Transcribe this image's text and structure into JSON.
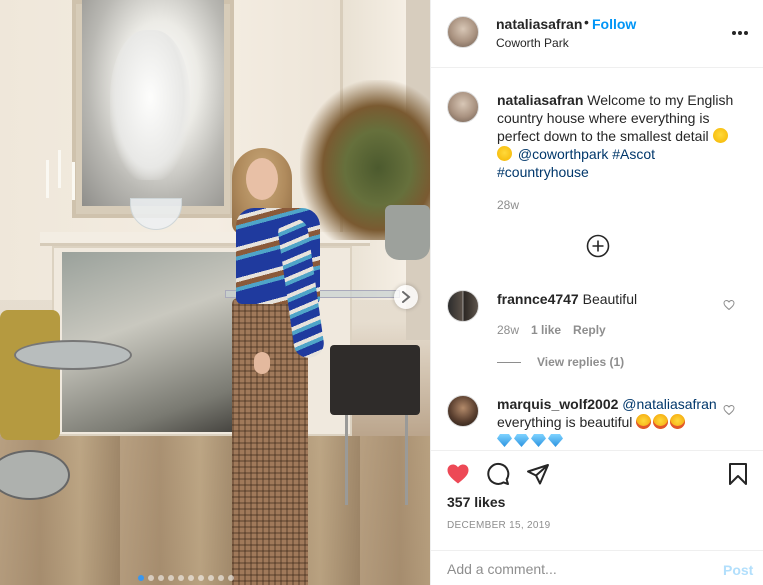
{
  "header": {
    "username": "nataliasafran",
    "separator": "•",
    "follow_label": "Follow",
    "location": "Coworth Park"
  },
  "caption": {
    "username": "nataliasafran",
    "text_line": "Welcome to my English country house where everything is perfect down to the smallest detail",
    "mention": "@coworthpark",
    "hashtag1": "#Ascot",
    "hashtag2": "#countryhouse",
    "age": "28w"
  },
  "comments": [
    {
      "username": "frannce4747",
      "text": "Beautiful",
      "age": "28w",
      "likes": "1 like",
      "reply_label": "Reply",
      "view_replies": "View replies (1)"
    },
    {
      "username": "marquis_wolf2002",
      "mention": "@nataliasafran",
      "text": "everything is beautiful"
    }
  ],
  "actions": {
    "likes": "357 likes",
    "date": "DECEMBER 15, 2019"
  },
  "add_comment": {
    "placeholder": "Add a comment...",
    "post_label": "Post"
  },
  "icons": {
    "like": "heart-filled-icon",
    "comment": "comment-bubble-icon",
    "share": "paper-plane-icon",
    "save": "bookmark-icon",
    "more": "more-options-icon",
    "load_more": "plus-circle-icon",
    "next": "chevron-right-icon"
  },
  "colors": {
    "accent": "#0095f6",
    "like_red": "#ed4956",
    "link": "#00376b",
    "muted": "#8e8e8e",
    "post_disabled": "#b2dffc"
  },
  "carousel": {
    "slides": 10,
    "active_index": 0
  }
}
